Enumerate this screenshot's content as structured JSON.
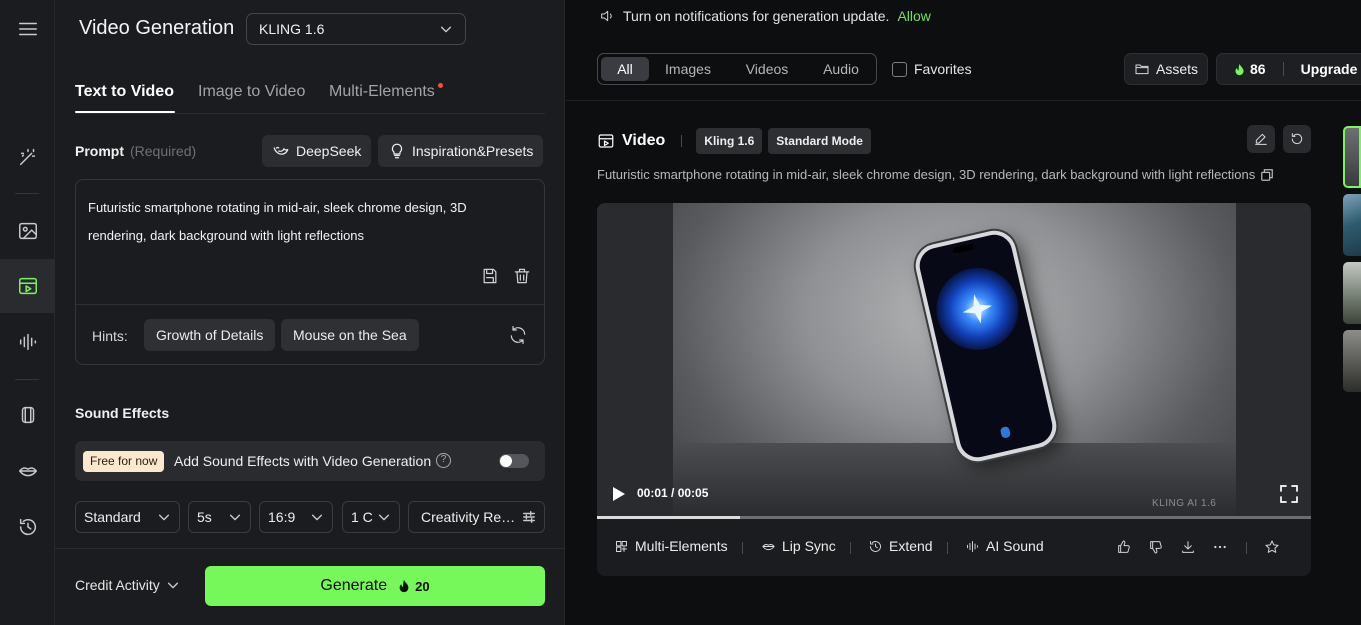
{
  "app": {
    "title": "Video Generation"
  },
  "model_select": {
    "value": "KLING 1.6"
  },
  "tabs": [
    {
      "label": "Text to Video"
    },
    {
      "label": "Image to Video"
    },
    {
      "label": "Multi-Elements"
    }
  ],
  "prompt": {
    "label": "Prompt",
    "required_note": "(Required)",
    "deepseek_label": "DeepSeek",
    "inspiration_label": "Inspiration&Presets",
    "value": "Futuristic smartphone rotating in mid-air, sleek chrome design, 3D rendering, dark background with light reflections"
  },
  "hints": {
    "label": "Hints:",
    "items": [
      "Growth of Details",
      "Mouse on the Sea"
    ]
  },
  "sound_effects": {
    "title": "Sound Effects",
    "badge": "Free for now",
    "label": "Add Sound Effects with Video Generation",
    "help": "?",
    "enabled": false
  },
  "options": {
    "mode": "Standard",
    "duration": "5s",
    "ratio": "16:9",
    "count": "1 C",
    "creativity": "Creativity Re…"
  },
  "footer": {
    "credit_activity": "Credit Activity",
    "generate_label": "Generate",
    "generate_cost": "20"
  },
  "notification": {
    "text": "Turn on notifications for generation update.",
    "allow": "Allow"
  },
  "filters": {
    "items": [
      "All",
      "Images",
      "Videos",
      "Audio"
    ],
    "active": "All",
    "favorites": "Favorites"
  },
  "header_right": {
    "assets": "Assets",
    "credits": "86",
    "upgrade": "Upgrade"
  },
  "video": {
    "title": "Video",
    "tags": [
      "Kling 1.6",
      "Standard Mode"
    ],
    "description": "Futuristic smartphone rotating in mid-air, sleek chrome design, 3D rendering, dark background with light reflections",
    "time": "00:01 / 00:05",
    "progress": 0.2,
    "watermark": "KLING AI 1.6"
  },
  "actions": {
    "multi": "Multi-Elements",
    "lipsync": "Lip Sync",
    "extend": "Extend",
    "aisound": "AI Sound"
  },
  "colors": {
    "accent": "#76f75a",
    "background": "#0d0e10",
    "panel": "#1b1c1f",
    "notification_dot": "#ff4a3d"
  }
}
